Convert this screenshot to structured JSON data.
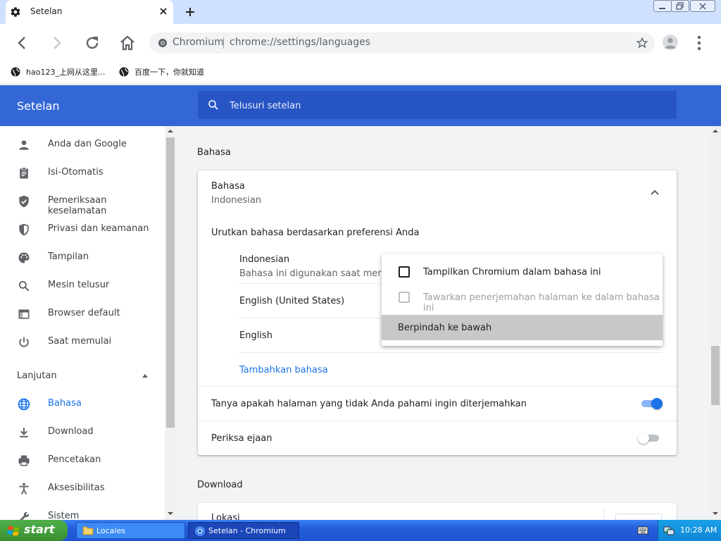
{
  "colors": {
    "accent": "#1a73e8",
    "header": "#3367d6",
    "search_bg": "#2755c4",
    "tab_strip": "#cfe1ff",
    "page_bg": "#f1f3f4",
    "toggle_on": "#1a73e8",
    "toggle_off": "#bdc1c6"
  },
  "tab": {
    "title": "Setelan",
    "icon": "gear-icon"
  },
  "toolbar": {
    "omnibox_site": "Chromium",
    "omnibox_url": "chrome://settings/languages"
  },
  "bookmarks": [
    {
      "label": "hao123_上网从这里..."
    },
    {
      "label": "百度一下，你就知道"
    }
  ],
  "header": {
    "title": "Setelan",
    "search_placeholder": "Telusuri setelan"
  },
  "sidebar": {
    "items": [
      {
        "label": "Anda dan Google",
        "icon": "person-icon"
      },
      {
        "label": "Isi-Otomatis",
        "icon": "clipboard-icon"
      },
      {
        "label": "Pemeriksaan keselamatan",
        "icon": "shield-check-icon"
      },
      {
        "label": "Privasi dan keamanan",
        "icon": "shield-icon"
      },
      {
        "label": "Tampilan",
        "icon": "palette-icon"
      },
      {
        "label": "Mesin telusur",
        "icon": "search-icon"
      },
      {
        "label": "Browser default",
        "icon": "browser-icon"
      },
      {
        "label": "Saat memulai",
        "icon": "power-icon"
      }
    ],
    "advanced_label": "Lanjutan",
    "advanced_items": [
      {
        "label": "Bahasa",
        "icon": "globe-icon",
        "active": true
      },
      {
        "label": "Download",
        "icon": "download-icon"
      },
      {
        "label": "Pencetakan",
        "icon": "printer-icon"
      },
      {
        "label": "Aksesibilitas",
        "icon": "accessibility-icon"
      },
      {
        "label": "Sistem",
        "icon": "wrench-icon"
      }
    ]
  },
  "languages": {
    "section_title": "Bahasa",
    "expand_title": "Bahasa",
    "expand_value": "Indonesian",
    "order_label": "Urutkan bahasa berdasarkan preferensi Anda",
    "list": [
      {
        "name": "Indonesian",
        "note": "Bahasa ini digunakan saat menerje"
      },
      {
        "name": "English (United States)"
      },
      {
        "name": "English"
      }
    ],
    "add_language": "Tambahkan bahasa",
    "translate_offer_label": "Tanya apakah halaman yang tidak Anda pahami ingin diterjemahkan",
    "translate_offer_on": true,
    "spellcheck_label": "Periksa ejaan",
    "spellcheck_on": false
  },
  "popup_menu": {
    "items": [
      {
        "label": "Tampilkan Chromium dalam bahasa ini",
        "checked": false,
        "disabled": false
      },
      {
        "label": "Tawarkan penerjemahan halaman ke dalam bahasa ini",
        "checked": false,
        "disabled": true
      },
      {
        "label": "Berpindah ke bawah",
        "highlighted": true
      }
    ]
  },
  "downloads": {
    "section_title": "Download",
    "location_label": "Lokasi"
  },
  "taskbar": {
    "start_label": "start",
    "tasks": [
      {
        "label": "Locales",
        "icon": "folder-icon"
      },
      {
        "label": "Setelan - Chromium",
        "icon": "chromium-icon"
      }
    ],
    "clock": "10:28 AM"
  }
}
